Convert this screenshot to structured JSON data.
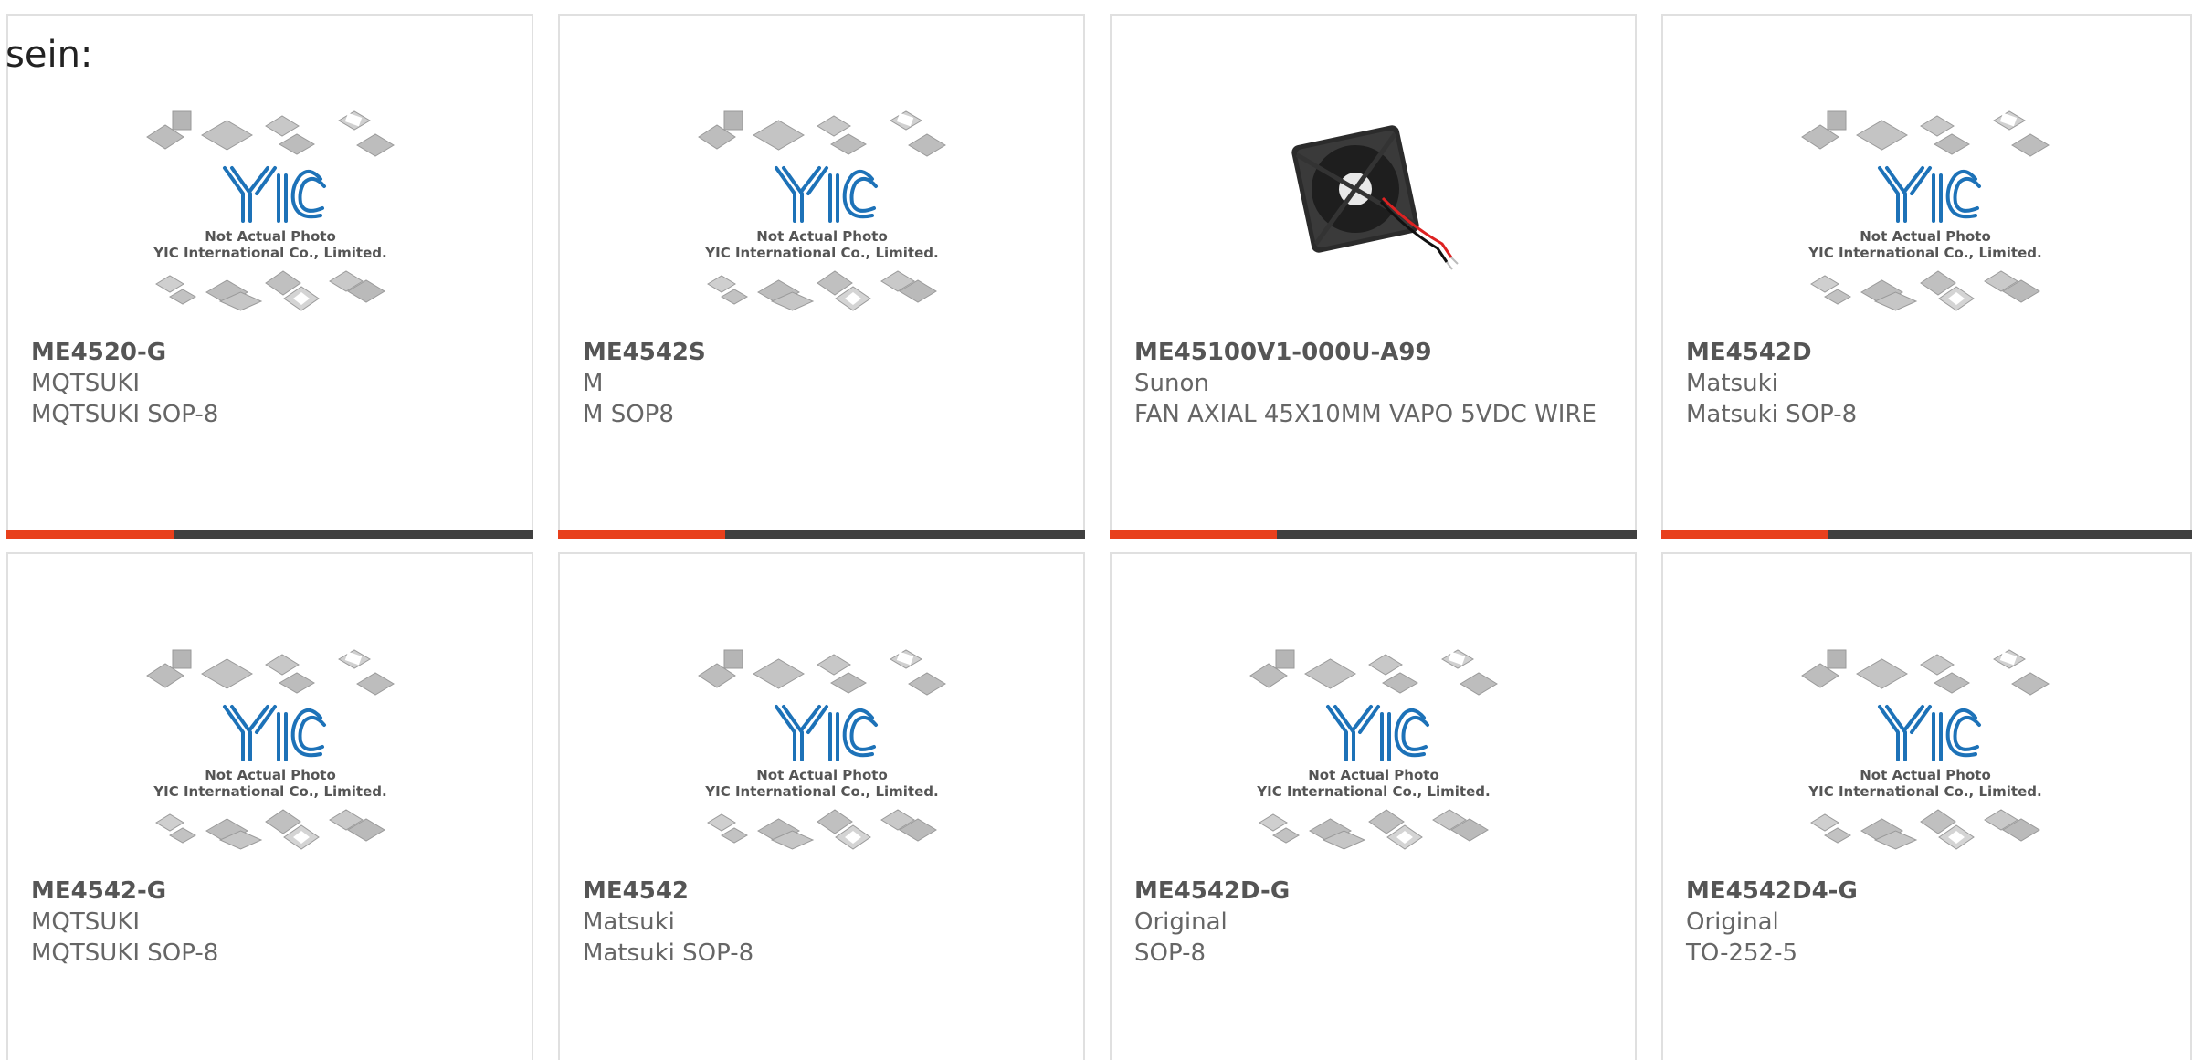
{
  "lead_text": "sein:",
  "placeholder_photo": {
    "line1": "Not Actual Photo",
    "line2": "YIC International Co., Limited.",
    "logo": "YIC"
  },
  "colors": {
    "accent": "#e8401c",
    "bar": "#404040",
    "logo_blue": "#1d72b8"
  },
  "products": [
    {
      "part": "ME4520-G",
      "brand": "MQTSUKI",
      "desc": "MQTSUKI SOP-8",
      "image": "placeholder"
    },
    {
      "part": "ME4542S",
      "brand": "M",
      "desc": "M SOP8",
      "image": "placeholder"
    },
    {
      "part": "ME45100V1-000U-A99",
      "brand": "Sunon",
      "desc": "FAN AXIAL 45X10MM VAPO 5VDC WIRE",
      "image": "fan"
    },
    {
      "part": "ME4542D",
      "brand": "Matsuki",
      "desc": "Matsuki SOP-8",
      "image": "placeholder"
    },
    {
      "part": "ME4542-G",
      "brand": "MQTSUKI",
      "desc": "MQTSUKI SOP-8",
      "image": "placeholder"
    },
    {
      "part": "ME4542",
      "brand": "Matsuki",
      "desc": "Matsuki SOP-8",
      "image": "placeholder"
    },
    {
      "part": "ME4542D-G",
      "brand": "Original",
      "desc": "SOP-8",
      "image": "placeholder"
    },
    {
      "part": "ME4542D4-G",
      "brand": "Original",
      "desc": "TO-252-5",
      "image": "placeholder"
    }
  ]
}
